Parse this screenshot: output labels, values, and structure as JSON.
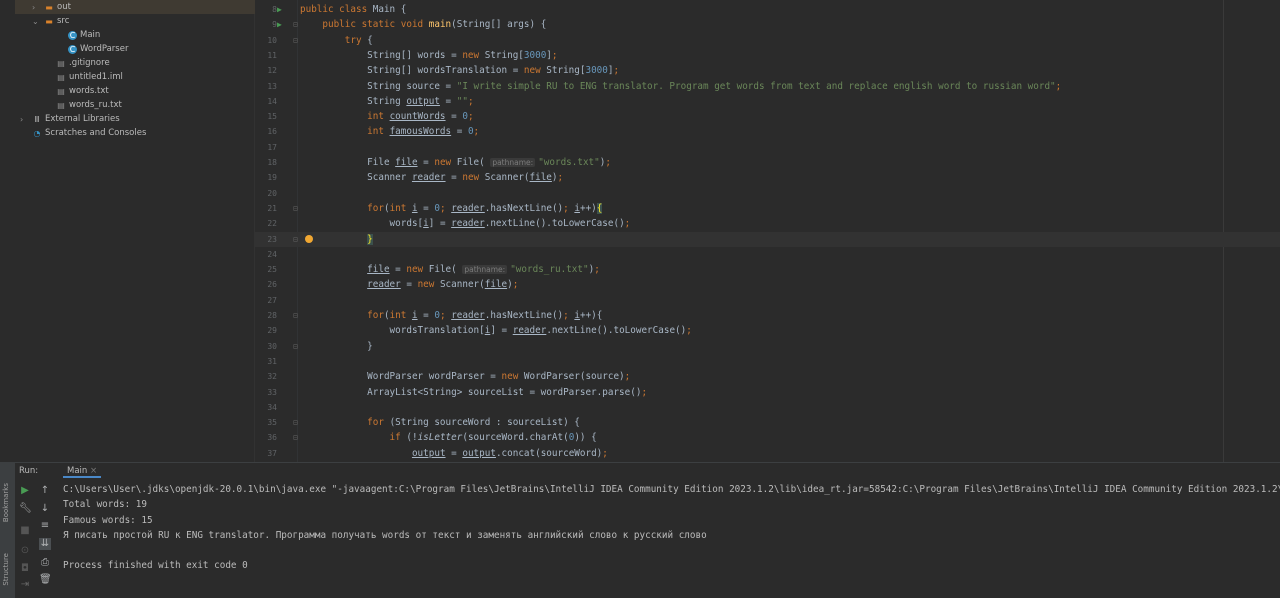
{
  "project": {
    "items": [
      {
        "label": "out",
        "icon": "folder-icon",
        "indent": 1,
        "chevron": ">",
        "selected": true
      },
      {
        "label": "src",
        "icon": "folder-icon",
        "indent": 1,
        "chevron": "v"
      },
      {
        "label": "Main",
        "icon": "class-icon",
        "indent": 3
      },
      {
        "label": "WordParser",
        "icon": "class-icon",
        "indent": 3
      },
      {
        "label": ".gitignore",
        "icon": "file-icon",
        "indent": 2
      },
      {
        "label": "untitled1.iml",
        "icon": "file-icon",
        "indent": 2
      },
      {
        "label": "words.txt",
        "icon": "text-file-icon",
        "indent": 2
      },
      {
        "label": "words_ru.txt",
        "icon": "text-file-icon",
        "indent": 2
      },
      {
        "label": "External Libraries",
        "icon": "library-icon",
        "indent": 0,
        "chevron": ">"
      },
      {
        "label": "Scratches and Consoles",
        "icon": "scratches-icon",
        "indent": 0
      }
    ]
  },
  "editor": {
    "current_line": 23,
    "lines": [
      {
        "n": "8",
        "run": true,
        "t": [
          [
            "public class ",
            "k"
          ],
          [
            "Main {",
            "p"
          ]
        ]
      },
      {
        "n": "9",
        "run": true,
        "fold": true,
        "t": [
          [
            "    public static void ",
            "k"
          ],
          [
            "main",
            "m"
          ],
          [
            "(String[] args) {",
            "p"
          ]
        ]
      },
      {
        "n": "10",
        "fold": true,
        "t": [
          [
            "        try ",
            "k"
          ],
          [
            "{",
            "p"
          ]
        ]
      },
      {
        "n": "11",
        "t": [
          [
            "            String[] words = ",
            "p"
          ],
          [
            "new ",
            "k"
          ],
          [
            "String[",
            "p"
          ],
          [
            "3000",
            "n"
          ],
          [
            "]",
            "p"
          ],
          [
            ";",
            "k"
          ]
        ]
      },
      {
        "n": "12",
        "t": [
          [
            "            String[] wordsTranslation = ",
            "p"
          ],
          [
            "new ",
            "k"
          ],
          [
            "String[",
            "p"
          ],
          [
            "3000",
            "n"
          ],
          [
            "]",
            "p"
          ],
          [
            ";",
            "k"
          ]
        ]
      },
      {
        "n": "13",
        "t": [
          [
            "            String source = ",
            "p"
          ],
          [
            "\"I write simple RU to ENG translator. Program get words from text and replace english word to russian word\"",
            "s"
          ],
          [
            ";",
            "k"
          ]
        ]
      },
      {
        "n": "14",
        "t": [
          [
            "            String ",
            "p"
          ],
          [
            "output",
            "u"
          ],
          [
            " = ",
            "p"
          ],
          [
            "\"\"",
            "s"
          ],
          [
            ";",
            "k"
          ]
        ]
      },
      {
        "n": "15",
        "t": [
          [
            "            int ",
            "k"
          ],
          [
            "countWords",
            "u"
          ],
          [
            " = ",
            "p"
          ],
          [
            "0",
            "n"
          ],
          [
            ";",
            "k"
          ]
        ]
      },
      {
        "n": "16",
        "t": [
          [
            "            int ",
            "k"
          ],
          [
            "famousWords",
            "u"
          ],
          [
            " = ",
            "p"
          ],
          [
            "0",
            "n"
          ],
          [
            ";",
            "k"
          ]
        ]
      },
      {
        "n": "17",
        "t": []
      },
      {
        "n": "18",
        "t": [
          [
            "            File ",
            "p"
          ],
          [
            "file",
            "u"
          ],
          [
            " = ",
            "p"
          ],
          [
            "new ",
            "k"
          ],
          [
            "File( ",
            "p"
          ],
          [
            "pathname:",
            "h"
          ],
          [
            "\"words.txt\"",
            "s"
          ],
          [
            ")",
            "p"
          ],
          [
            ";",
            "k"
          ]
        ]
      },
      {
        "n": "19",
        "t": [
          [
            "            Scanner ",
            "p"
          ],
          [
            "reader",
            "u"
          ],
          [
            " = ",
            "p"
          ],
          [
            "new ",
            "k"
          ],
          [
            "Scanner(",
            "p"
          ],
          [
            "file",
            "u"
          ],
          [
            ")",
            "p"
          ],
          [
            ";",
            "k"
          ]
        ]
      },
      {
        "n": "20",
        "t": []
      },
      {
        "n": "21",
        "fold": true,
        "t": [
          [
            "            for",
            "k"
          ],
          [
            "(",
            "p"
          ],
          [
            "int ",
            "k"
          ],
          [
            "i",
            "u"
          ],
          [
            " = ",
            "p"
          ],
          [
            "0",
            "n"
          ],
          [
            "; ",
            "k"
          ],
          [
            "reader",
            "u"
          ],
          [
            ".hasNextLine()",
            "p"
          ],
          [
            "; ",
            "k"
          ],
          [
            "i",
            "u"
          ],
          [
            "++)",
            "p"
          ],
          [
            "{",
            "o"
          ]
        ]
      },
      {
        "n": "22",
        "t": [
          [
            "                words[",
            "p"
          ],
          [
            "i",
            "u"
          ],
          [
            "] = ",
            "p"
          ],
          [
            "reader",
            "u"
          ],
          [
            ".nextLine().toLowerCase()",
            "p"
          ],
          [
            ";",
            "k"
          ]
        ]
      },
      {
        "n": "23",
        "fold": true,
        "bulb": true,
        "t": [
          [
            "            ",
            "p"
          ],
          [
            "}",
            "o"
          ]
        ]
      },
      {
        "n": "24",
        "t": []
      },
      {
        "n": "25",
        "t": [
          [
            "            ",
            "p"
          ],
          [
            "file",
            "u"
          ],
          [
            " = ",
            "p"
          ],
          [
            "new ",
            "k"
          ],
          [
            "File( ",
            "p"
          ],
          [
            "pathname:",
            "h"
          ],
          [
            "\"words_ru.txt\"",
            "s"
          ],
          [
            ")",
            "p"
          ],
          [
            ";",
            "k"
          ]
        ]
      },
      {
        "n": "26",
        "t": [
          [
            "            ",
            "p"
          ],
          [
            "reader",
            "u"
          ],
          [
            " = ",
            "p"
          ],
          [
            "new ",
            "k"
          ],
          [
            "Scanner(",
            "p"
          ],
          [
            "file",
            "u"
          ],
          [
            ")",
            "p"
          ],
          [
            ";",
            "k"
          ]
        ]
      },
      {
        "n": "27",
        "t": []
      },
      {
        "n": "28",
        "fold": true,
        "t": [
          [
            "            for",
            "k"
          ],
          [
            "(",
            "p"
          ],
          [
            "int ",
            "k"
          ],
          [
            "i",
            "u"
          ],
          [
            " = ",
            "p"
          ],
          [
            "0",
            "n"
          ],
          [
            "; ",
            "k"
          ],
          [
            "reader",
            "u"
          ],
          [
            ".hasNextLine()",
            "p"
          ],
          [
            "; ",
            "k"
          ],
          [
            "i",
            "u"
          ],
          [
            "++){",
            "p"
          ]
        ]
      },
      {
        "n": "29",
        "t": [
          [
            "                wordsTranslation[",
            "p"
          ],
          [
            "i",
            "u"
          ],
          [
            "] = ",
            "p"
          ],
          [
            "reader",
            "u"
          ],
          [
            ".nextLine().toLowerCase()",
            "p"
          ],
          [
            ";",
            "k"
          ]
        ]
      },
      {
        "n": "30",
        "fold": true,
        "t": [
          [
            "            }",
            "p"
          ]
        ]
      },
      {
        "n": "31",
        "t": []
      },
      {
        "n": "32",
        "t": [
          [
            "            WordParser wordParser = ",
            "p"
          ],
          [
            "new ",
            "k"
          ],
          [
            "WordParser(source)",
            "p"
          ],
          [
            ";",
            "k"
          ]
        ]
      },
      {
        "n": "33",
        "t": [
          [
            "            ArrayList<String> sourceList = wordParser.parse()",
            "p"
          ],
          [
            ";",
            "k"
          ]
        ]
      },
      {
        "n": "34",
        "t": []
      },
      {
        "n": "35",
        "fold": true,
        "t": [
          [
            "            for ",
            "k"
          ],
          [
            "(String sourceWord : sourceList) {",
            "p"
          ]
        ]
      },
      {
        "n": "36",
        "fold": true,
        "t": [
          [
            "                if ",
            "k"
          ],
          [
            "(!",
            "p"
          ],
          [
            "isLetter",
            "i"
          ],
          [
            "(sourceWord.charAt(",
            "p"
          ],
          [
            "0",
            "n"
          ],
          [
            ")) {",
            "p"
          ]
        ]
      },
      {
        "n": "37",
        "t": [
          [
            "                    ",
            "p"
          ],
          [
            "output",
            "u"
          ],
          [
            " = ",
            "p"
          ],
          [
            "output",
            "u"
          ],
          [
            ".concat(sourceWord)",
            "p"
          ],
          [
            ";",
            "k"
          ]
        ]
      }
    ]
  },
  "run": {
    "label": "Run:",
    "tab": "Main",
    "side_labels": {
      "bookmarks": "Bookmarks",
      "structure": "Structure"
    },
    "console": [
      "C:\\Users\\User\\.jdks\\openjdk-20.0.1\\bin\\java.exe \"-javaagent:C:\\Program Files\\JetBrains\\IntelliJ IDEA Community Edition 2023.1.2\\lib\\idea_rt.jar=58542:C:\\Program Files\\JetBrains\\IntelliJ IDEA Community Edition 2023.1.2\\b",
      "Total words: 19",
      "Famous words: 15",
      "Я писать простой RU к ENG translator. Программа получать words от текст и заменять английский слово к русский слово",
      "",
      "Process finished with exit code 0"
    ]
  }
}
